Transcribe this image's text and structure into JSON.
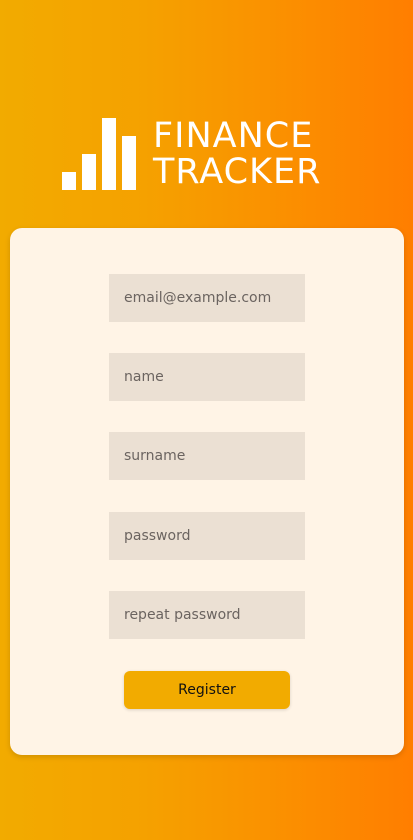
{
  "logo": {
    "line1": "FINANCE",
    "line2": "TRACKER",
    "icon": "bar-chart-icon"
  },
  "form": {
    "email_placeholder": "email@example.com",
    "name_placeholder": "name",
    "surname_placeholder": "surname",
    "password_placeholder": "password",
    "repeat_password_placeholder": "repeat password",
    "register_label": "Register"
  },
  "colors": {
    "gradient_start": "#f2ab00",
    "gradient_end": "#ff7e00",
    "card_background": "#fff4e6",
    "input_background": "#ebe0d3",
    "button_background": "#f2ab00"
  }
}
